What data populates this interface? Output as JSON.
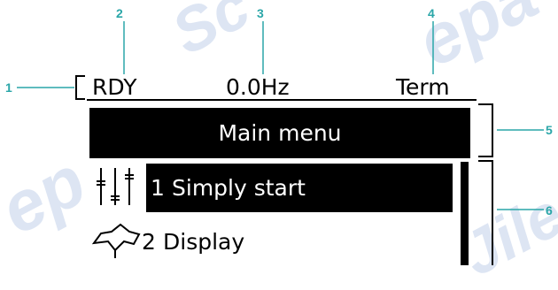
{
  "watermark": [
    "Sc",
    "epa",
    "ep",
    "Jile"
  ],
  "callouts": [
    "1",
    "2",
    "3",
    "4",
    "5",
    "6"
  ],
  "status_bar": {
    "state": "RDY",
    "frequency": "0.0Hz",
    "channel": "Term"
  },
  "header": {
    "title": "Main menu"
  },
  "menu": {
    "items": [
      {
        "number": "1",
        "label": "Simply start",
        "icon": "sliders-icon",
        "selected": true
      },
      {
        "number": "2",
        "label": "Display",
        "icon": "display-icon",
        "selected": false
      }
    ]
  },
  "colors": {
    "callout": "#2aa6a8",
    "watermark": "#dde5f3",
    "screen_fg": "#000000",
    "screen_bg": "#ffffff"
  }
}
